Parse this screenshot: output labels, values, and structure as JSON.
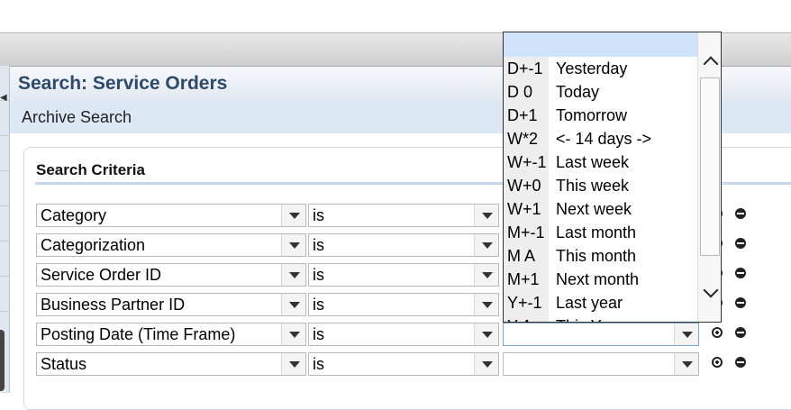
{
  "page": {
    "title": "Search: Service Orders",
    "subtitle": "Archive Search"
  },
  "criteria": {
    "title": "Search Criteria",
    "rows": [
      {
        "attribute": "Category",
        "operator": "is",
        "value": ""
      },
      {
        "attribute": "Categorization",
        "operator": "is",
        "value": ""
      },
      {
        "attribute": "Service Order ID",
        "operator": "is",
        "value": ""
      },
      {
        "attribute": "Business Partner ID",
        "operator": "is",
        "value": ""
      },
      {
        "attribute": "Posting Date (Time Frame)",
        "operator": "is",
        "value": ""
      },
      {
        "attribute": "Status",
        "operator": "is",
        "value": ""
      }
    ]
  },
  "timeframe_dropdown": {
    "items": [
      {
        "code": "D+-1",
        "label": "Yesterday"
      },
      {
        "code": "D 0",
        "label": "Today"
      },
      {
        "code": "D+1",
        "label": "Tomorrow"
      },
      {
        "code": "W*2",
        "label": "<- 14 days ->"
      },
      {
        "code": "W+-1",
        "label": "Last week"
      },
      {
        "code": "W+0",
        "label": "This week"
      },
      {
        "code": "W+1",
        "label": "Next week"
      },
      {
        "code": "M+-1",
        "label": "Last month"
      },
      {
        "code": "M A",
        "label": "This month"
      },
      {
        "code": "M+1",
        "label": "Next month"
      },
      {
        "code": "Y+-1",
        "label": "Last year"
      },
      {
        "code": "Y A",
        "label": "This Year"
      }
    ]
  },
  "icons": {
    "add_row": "plus-circle-icon",
    "remove_row": "minus-circle-icon",
    "dropdown": "chevron-down-icon",
    "scroll_up": "chevron-up-icon",
    "scroll_down": "chevron-down-icon"
  }
}
